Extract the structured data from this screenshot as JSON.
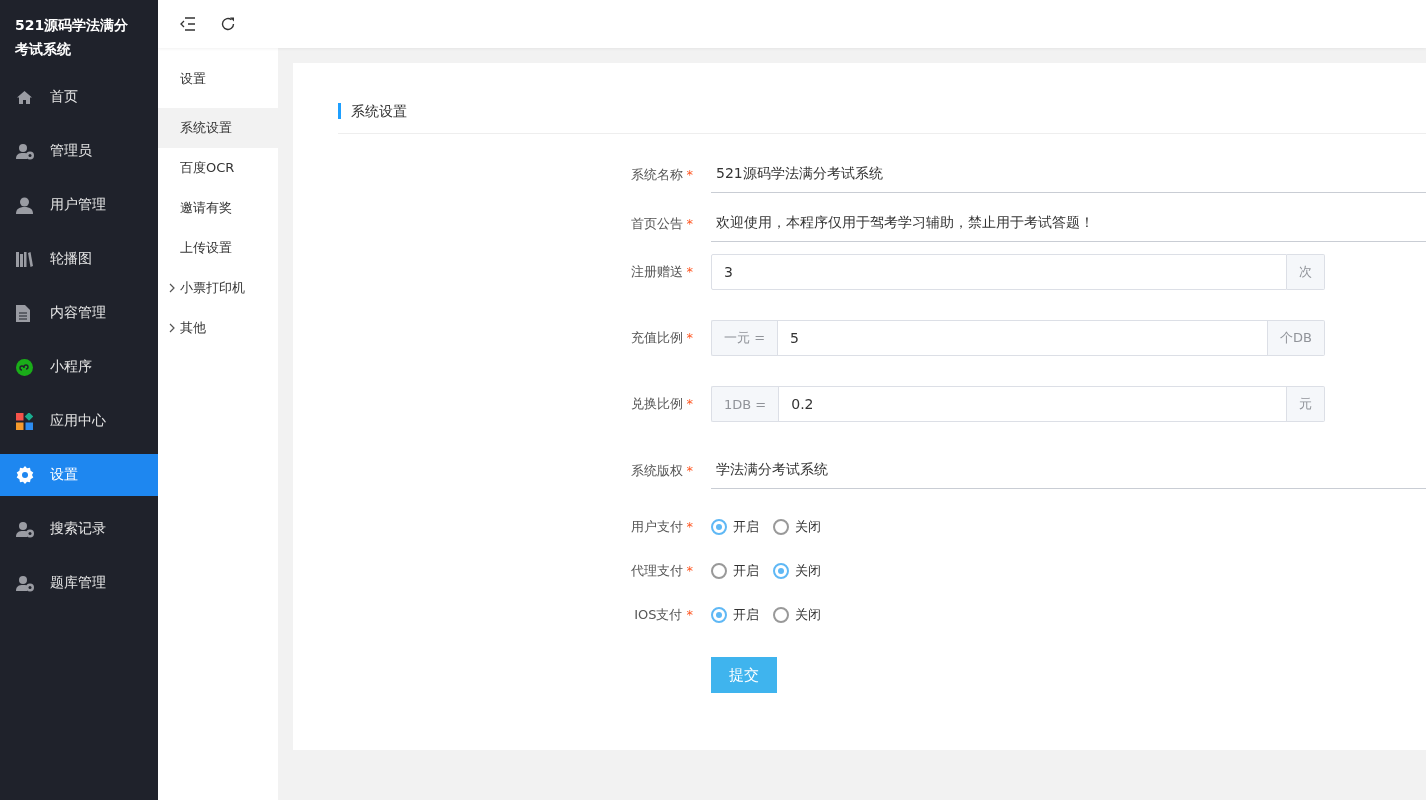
{
  "app_title": "521源码学法满分考试系统",
  "sidebar": {
    "items": [
      {
        "kind": "home",
        "label": "首页",
        "selected": false
      },
      {
        "kind": "admin",
        "label": "管理员",
        "selected": false
      },
      {
        "kind": "user",
        "label": "用户管理",
        "selected": false
      },
      {
        "kind": "gallery",
        "label": "轮播图",
        "selected": false
      },
      {
        "kind": "document",
        "label": "内容管理",
        "selected": false
      },
      {
        "kind": "miniapp",
        "label": "小程序",
        "selected": false
      },
      {
        "kind": "apps",
        "label": "应用中心",
        "selected": false
      },
      {
        "kind": "settings",
        "label": "设置",
        "selected": true
      },
      {
        "kind": "admin",
        "label": "搜索记录",
        "selected": false
      },
      {
        "kind": "admin",
        "label": "题库管理",
        "selected": false
      }
    ]
  },
  "submenu": {
    "title": "设置",
    "items": [
      {
        "kind": "link",
        "label": "系统设置",
        "selected": true
      },
      {
        "kind": "link",
        "label": "百度OCR",
        "selected": false
      },
      {
        "kind": "link",
        "label": "邀请有奖",
        "selected": false
      },
      {
        "kind": "link",
        "label": "上传设置",
        "selected": false
      },
      {
        "kind": "group",
        "label": "小票打印机",
        "selected": false
      },
      {
        "kind": "group",
        "label": "其他",
        "selected": false
      }
    ]
  },
  "panel": {
    "title": "系统设置",
    "fields": [
      {
        "kind": "line",
        "label": "系统名称",
        "required_mark": "*",
        "value": "521源码学法满分考试系统"
      },
      {
        "kind": "line",
        "label": "首页公告",
        "required_mark": "*",
        "value": "欢迎使用，本程序仅用于驾考学习辅助，禁止用于考试答题！"
      },
      {
        "kind": "addon",
        "label": "注册赠送",
        "required_mark": "*",
        "value": "3",
        "suffix": "次"
      },
      {
        "kind": "addon",
        "label": "充值比例",
        "required_mark": "*",
        "prefix": "一元 =",
        "value": "5",
        "suffix": "个DB"
      },
      {
        "kind": "addon",
        "label": "兑换比例",
        "required_mark": "*",
        "prefix": "1DB =",
        "value": "0.2",
        "suffix": "元"
      },
      {
        "kind": "line",
        "label": "系统版权",
        "required_mark": "*",
        "value": "学法满分考试系统"
      },
      {
        "kind": "radio",
        "label": "用户支付",
        "required_mark": "*",
        "options": [
          {
            "label": "开启",
            "selected": true
          },
          {
            "label": "关闭",
            "selected": false
          }
        ]
      },
      {
        "kind": "radio",
        "label": "代理支付",
        "required_mark": "*",
        "options": [
          {
            "label": "开启",
            "selected": false
          },
          {
            "label": "关闭",
            "selected": true
          }
        ]
      },
      {
        "kind": "radio",
        "label": "IOS支付",
        "required_mark": "*",
        "options": [
          {
            "label": "开启",
            "selected": true
          },
          {
            "label": "关闭",
            "selected": false
          }
        ]
      }
    ],
    "submit": "提交"
  }
}
